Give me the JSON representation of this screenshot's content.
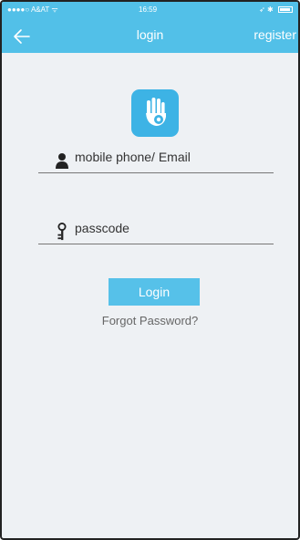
{
  "status": {
    "carrier": "●●●●○ A&AT ᯤ",
    "time": "16:59",
    "right": "➶ ✱"
  },
  "nav": {
    "title": "login",
    "register": "register",
    "back_icon": "arrow-left-icon"
  },
  "logo": {
    "icon": "hand-icon",
    "color": "#3db3e5"
  },
  "form": {
    "username_placeholder": "mobile phone/ Email",
    "password_placeholder": "passcode",
    "user_icon": "person-icon",
    "key_icon": "key-icon"
  },
  "actions": {
    "login": "Login",
    "forgot": "Forgot Password?"
  },
  "colors": {
    "accent": "#52c0e8",
    "background": "#eef1f4"
  }
}
